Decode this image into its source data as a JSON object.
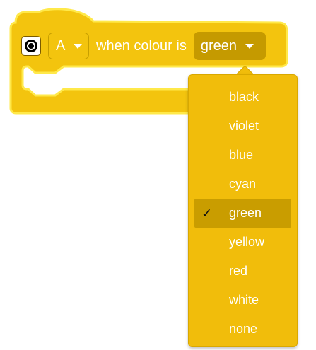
{
  "block": {
    "sensor_icon": "color-sensor-icon",
    "port": "A",
    "when_text": "when colour is",
    "selected_colour": "green",
    "colors": {
      "block_fill": "#f3c40e",
      "block_border": "#ffee55",
      "dropdown_dark": "#c59a00",
      "text": "#ffffff"
    }
  },
  "menu": {
    "items": [
      {
        "label": "black",
        "selected": false
      },
      {
        "label": "violet",
        "selected": false
      },
      {
        "label": "blue",
        "selected": false
      },
      {
        "label": "cyan",
        "selected": false
      },
      {
        "label": "green",
        "selected": true
      },
      {
        "label": "yellow",
        "selected": false
      },
      {
        "label": "red",
        "selected": false
      },
      {
        "label": "white",
        "selected": false
      },
      {
        "label": "none",
        "selected": false
      }
    ],
    "check_mark": "✓"
  }
}
